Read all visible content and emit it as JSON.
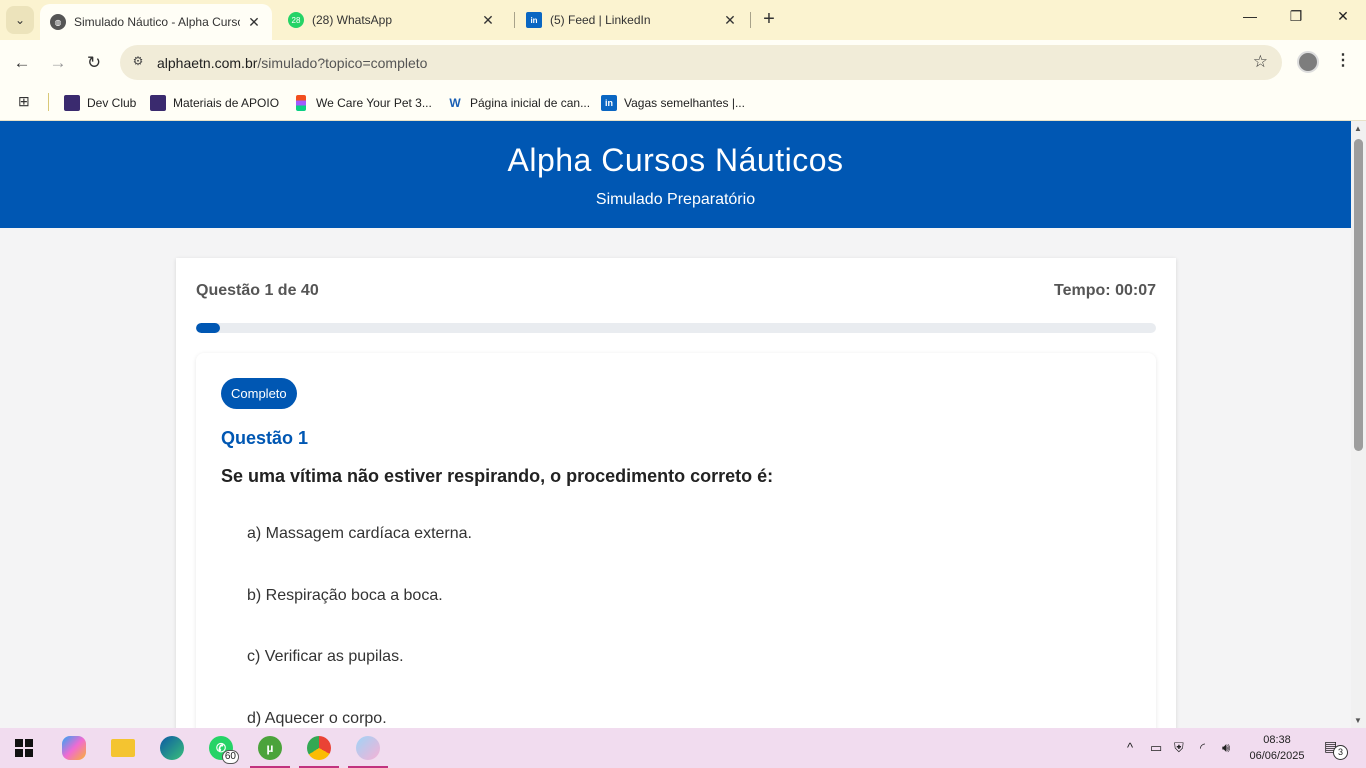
{
  "browser": {
    "tabs": [
      {
        "title": "Simulado Náutico - Alpha Curso",
        "favicon": "globe-icon",
        "active": true
      },
      {
        "title": "(28) WhatsApp",
        "favicon": "whatsapp-icon",
        "badge": "28",
        "active": false
      },
      {
        "title": "(5) Feed | LinkedIn",
        "favicon": "linkedin-icon",
        "active": false
      }
    ],
    "url_host": "alphaetn.com.br",
    "url_path": "/simulado?topico=completo",
    "bookmarks": [
      {
        "label": "Dev Club",
        "icon": "devclub-icon"
      },
      {
        "label": "Materiais de APOIO",
        "icon": "devclub-icon"
      },
      {
        "label": "We Care Your Pet 3...",
        "icon": "figma-icon"
      },
      {
        "label": "Página inicial de can...",
        "icon": "w-logo-icon"
      },
      {
        "label": "Vagas semelhantes |...",
        "icon": "linkedin-icon"
      }
    ]
  },
  "header": {
    "title": "Alpha Cursos Náuticos",
    "subtitle": "Simulado Preparatório"
  },
  "quiz": {
    "counter": "Questão 1 de 40",
    "timer": "Tempo: 00:07",
    "progress_fraction": 0.025,
    "topic_badge": "Completo",
    "question_label": "Questão 1",
    "question_text": "Se uma vítima não estiver respirando, o procedimento correto é:",
    "options": [
      "a) Massagem cardíaca externa.",
      "b) Respiração boca a boca.",
      "c) Verificar as pupilas.",
      "d) Aquecer o corpo."
    ]
  },
  "taskbar": {
    "whatsapp_badge": "60",
    "time": "08:38",
    "date": "06/06/2025",
    "notification_count": "3"
  },
  "colors": {
    "brand_blue": "#0057b3",
    "page_bg": "#f4f4f5",
    "chrome_bg": "#fbf3d0",
    "taskbar_bg": "#f1dcef"
  }
}
